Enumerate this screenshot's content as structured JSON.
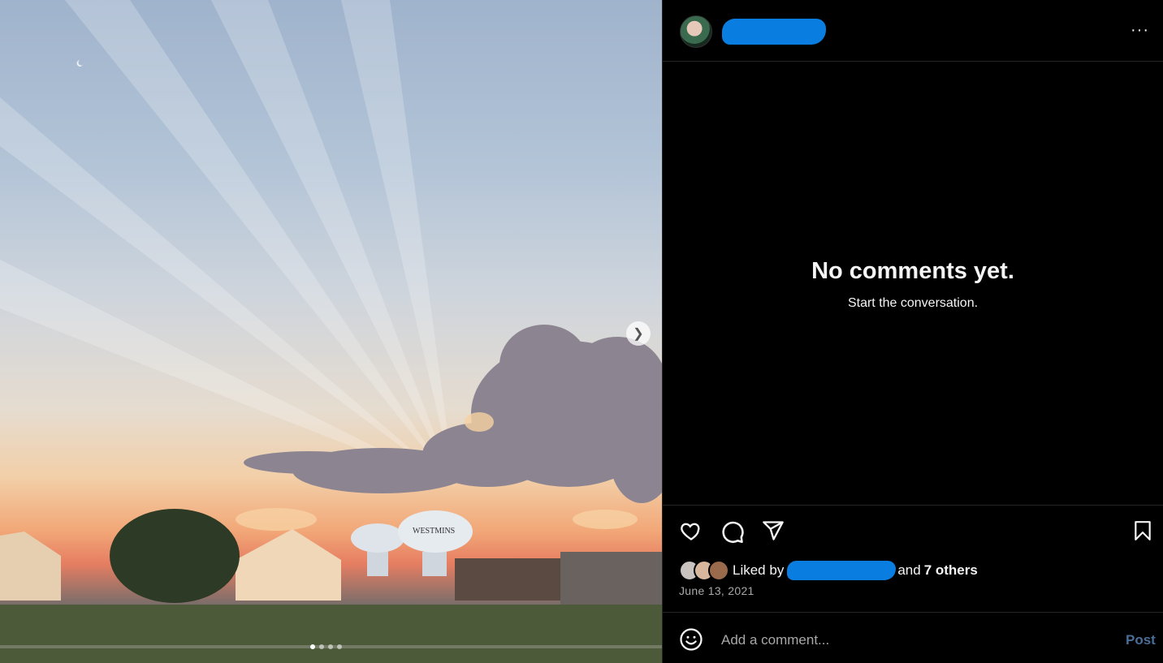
{
  "photo": {
    "alt_icons": {
      "next": "chevron-right-icon"
    },
    "carousel": {
      "count": 4,
      "active_index": 0
    },
    "tower_text": "WESTMINS"
  },
  "post": {
    "more_icon": "more-horizontal-icon",
    "empty_title": "No comments yet.",
    "empty_subtitle": "Start the conversation.",
    "liked_by_prefix": "Liked by",
    "liked_by_suffix": "and",
    "liked_by_others": "7 others",
    "date": "June 13, 2021"
  },
  "comment_bar": {
    "placeholder": "Add a comment...",
    "post_label": "Post"
  },
  "colors": {
    "background": "#000000",
    "redaction": "#0a7ee0",
    "post_button": "#4a6d99",
    "muted_text": "#a8a8a8"
  }
}
